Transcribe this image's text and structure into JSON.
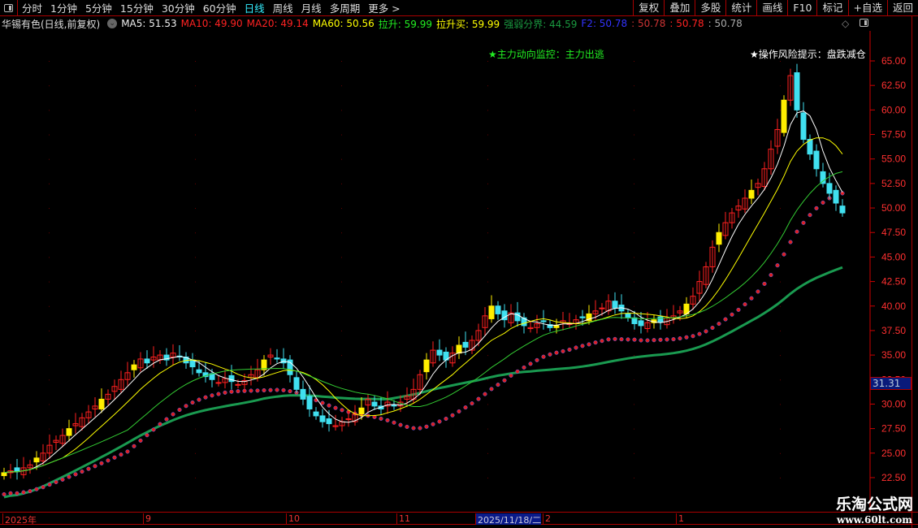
{
  "toolbar": {
    "periods": [
      "分时",
      "1分钟",
      "5分钟",
      "15分钟",
      "30分钟",
      "60分钟",
      "日线",
      "周线",
      "月线",
      "多周期",
      "更多 >"
    ],
    "active_period": "日线",
    "buttons": [
      "复权",
      "叠加",
      "多股",
      "统计",
      "画线",
      "F10",
      "标记",
      "+自选",
      "返回"
    ]
  },
  "info": {
    "title": "华锡有色(日线,前复权)",
    "ma5": "MA5: 51.53",
    "ma10": "MA10: 49.90",
    "ma20": "MA20: 49.14",
    "ma60": "MA60: 50.56",
    "lasheng": "拉升: 59.99",
    "lashengmai": "拉升买: 59.99",
    "qiangruo": "强弱分界: 44.59",
    "f2": "F2: 50.78",
    "v1": ": 50.78",
    "v2": ": 50.78",
    "v3": ": 50.78"
  },
  "notes": {
    "monitor": "★主力动向监控：主力出逃",
    "risk": "★操作风险提示：盘跌减仓"
  },
  "current_price_tag": "31.31",
  "watermark": {
    "name": "乐淘公式网",
    "url": "www.60lt.com"
  },
  "colors": {
    "up": "#ff2020",
    "down": "#40e0f0",
    "highlight": "#ffee00",
    "ma_long": "#1a9a50",
    "axis": "#ff3030"
  },
  "chart_data": {
    "type": "candlestick",
    "ylim": [
      21.5,
      68
    ],
    "y_ticks": [
      "65.00",
      "62.50",
      "60.00",
      "57.50",
      "55.00",
      "52.50",
      "50.00",
      "47.50",
      "45.00",
      "42.50",
      "40.00",
      "37.50",
      "35.00",
      "32.50",
      "30.00",
      "27.50",
      "25.00",
      "22.50"
    ],
    "x_labels": [
      {
        "label": "2025年",
        "index": 0
      },
      {
        "label": "9",
        "index": 22
      },
      {
        "label": "10",
        "index": 44
      },
      {
        "label": "11",
        "index": 61
      },
      {
        "label": "2025/11/18/二",
        "index": 72,
        "selected": true
      },
      {
        "label": "2",
        "index": 83
      },
      {
        "label": "1",
        "index": 104
      }
    ],
    "close": [
      23,
      23.2,
      23.1,
      23.5,
      23.8,
      24.5,
      25,
      25.8,
      26.3,
      26.8,
      27.5,
      28,
      28.6,
      29.2,
      29.8,
      30.5,
      31,
      31.8,
      32.5,
      33.2,
      34,
      34.6,
      34.2,
      34.8,
      35,
      34.5,
      35.2,
      34.8,
      34.2,
      33.8,
      33.2,
      32.8,
      32.5,
      32.2,
      32.6,
      32.3,
      32,
      32.4,
      33,
      33.5,
      34.5,
      35,
      34.6,
      34.2,
      33,
      31.5,
      30.5,
      29.5,
      28.8,
      28.2,
      28,
      27.8,
      28.2,
      28.5,
      29,
      29.6,
      30.5,
      29.8,
      29.5,
      30.2,
      29.8,
      30.2,
      30.8,
      31.5,
      33,
      34.5,
      35.5,
      35,
      34.5,
      35.2,
      36,
      35.8,
      36.5,
      37.5,
      39,
      40,
      39.2,
      38.6,
      39.3,
      38.5,
      38,
      37.8,
      38.2,
      38.4,
      37.8,
      38,
      38.5,
      38.2,
      38.6,
      38.8,
      39.2,
      39.5,
      39.8,
      40.5,
      39.8,
      39.5,
      38.8,
      38.2,
      38,
      38.3,
      38.6,
      38.4,
      38.8,
      39,
      39.5,
      40.2,
      41,
      42.5,
      44,
      46,
      47.5,
      48.5,
      49.5,
      50.2,
      51,
      51.8,
      52.5,
      54,
      56,
      58,
      61,
      63.5,
      60,
      57,
      55.5,
      54,
      52.5,
      51.5,
      50.5,
      49.5
    ],
    "moving_averages": [
      5,
      10,
      20,
      60
    ]
  }
}
